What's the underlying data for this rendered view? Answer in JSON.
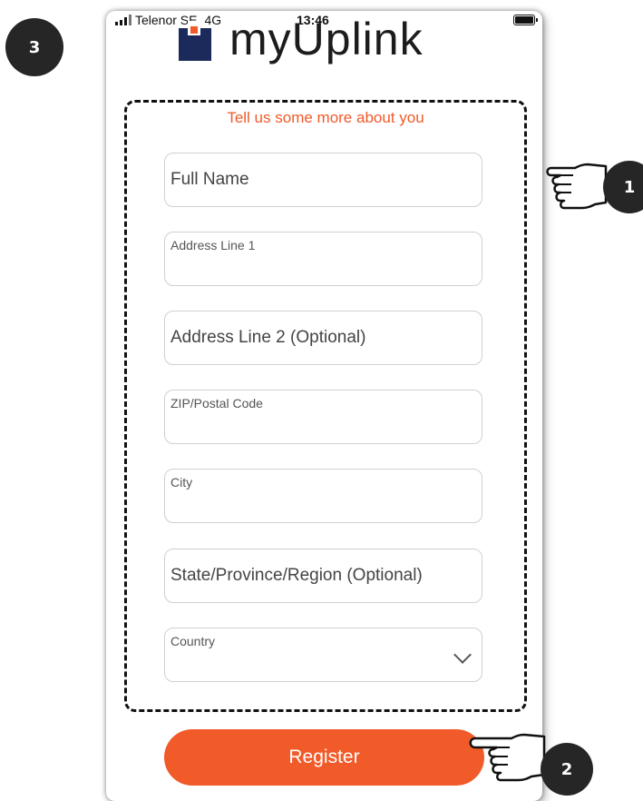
{
  "step_badges": {
    "main": "3",
    "form": "1",
    "register": "2"
  },
  "status_bar": {
    "carrier": "Telenor SE",
    "network": "4G",
    "time": "13:46"
  },
  "brand": {
    "name": "myUplink"
  },
  "form": {
    "subtitle": "Tell us some more about you",
    "fields": [
      {
        "label": "Full Name",
        "style": "placeholder"
      },
      {
        "label": "Address Line 1",
        "style": "floating"
      },
      {
        "label": "Address Line 2 (Optional)",
        "style": "placeholder"
      },
      {
        "label": "ZIP/Postal Code",
        "style": "floating"
      },
      {
        "label": "City",
        "style": "floating"
      },
      {
        "label": "State/Province/Region (Optional)",
        "style": "placeholder"
      },
      {
        "label": "Country",
        "style": "floating",
        "type": "select"
      }
    ],
    "register_label": "Register"
  },
  "colors": {
    "accent": "#f15a29",
    "badge": "#262626",
    "brand": "#1c2a5b"
  },
  "icons": [
    "signal-icon",
    "battery-icon",
    "chevron-down-icon",
    "pointing-hand-icon"
  ]
}
